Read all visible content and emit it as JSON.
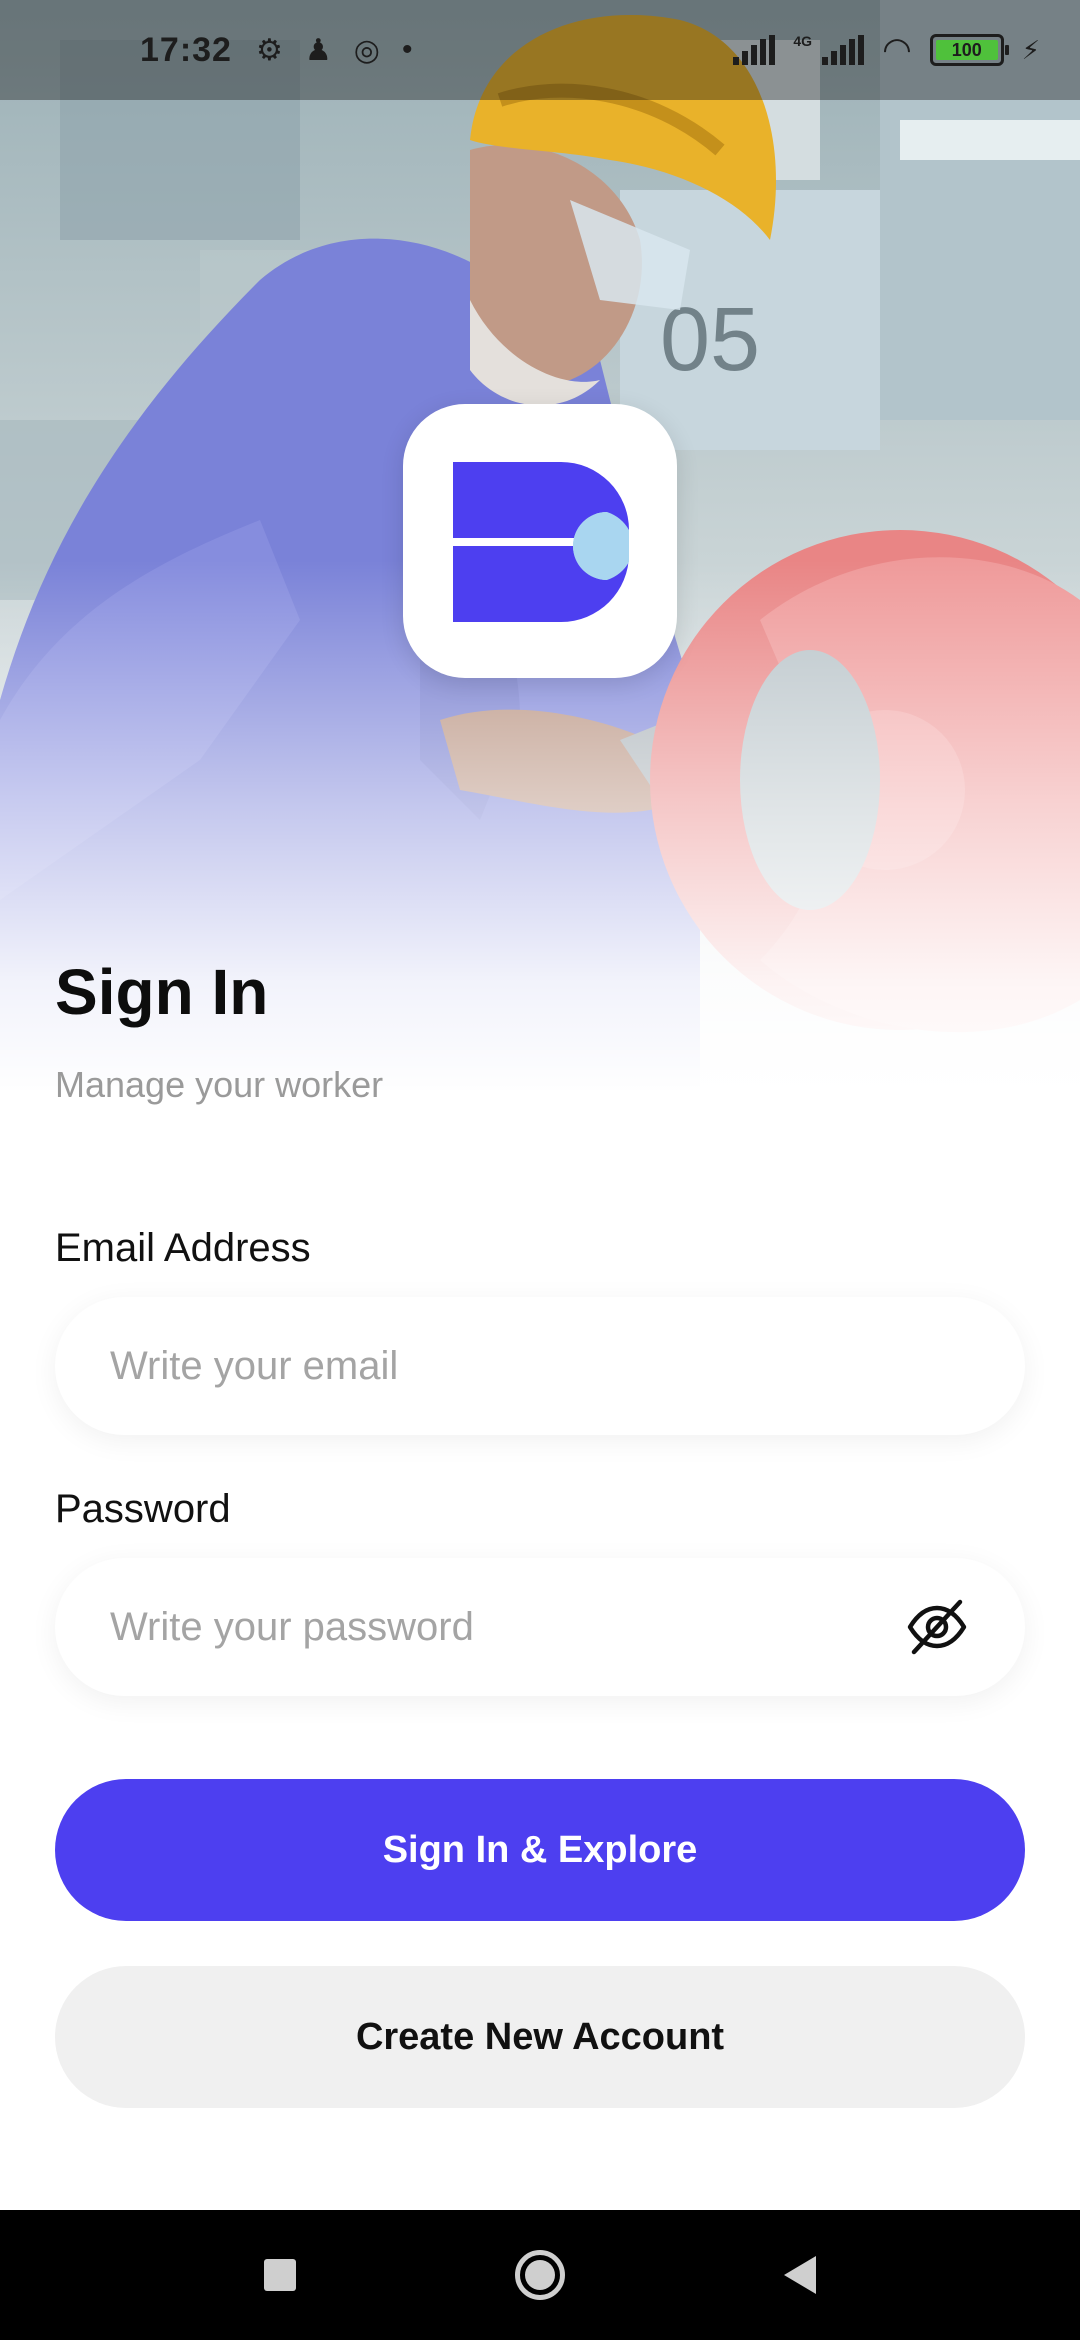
{
  "status_bar": {
    "time": "17:32",
    "network_label": "4G",
    "battery_level": "100",
    "left_icons": [
      "settings-icon",
      "notification-icon",
      "sync-icon",
      "dot-icon"
    ],
    "right_icons": [
      "signal-icon",
      "signal-4g-icon",
      "wifi-icon",
      "battery-icon",
      "charging-icon"
    ]
  },
  "hero": {
    "image": "worker-at-grinder-photo",
    "logo": "app-logo"
  },
  "header": {
    "title": "Sign In",
    "subtitle": "Manage your worker"
  },
  "form": {
    "email": {
      "label": "Email Address",
      "placeholder": "Write your email",
      "value": ""
    },
    "password": {
      "label": "Password",
      "placeholder": "Write your password",
      "value": "",
      "toggle_icon": "eye-off-icon"
    }
  },
  "actions": {
    "primary_label": "Sign In & Explore",
    "secondary_label": "Create New Account"
  },
  "colors": {
    "accent": "#4d3ff0",
    "logo_light": "#a9d6f0",
    "secondary_button_bg": "#f0f0f0",
    "placeholder_text": "#a4a4a4",
    "subtitle_text": "#9a9a9a"
  },
  "nav_bar": {
    "icons": [
      "recents-icon",
      "home-icon",
      "back-icon"
    ]
  }
}
